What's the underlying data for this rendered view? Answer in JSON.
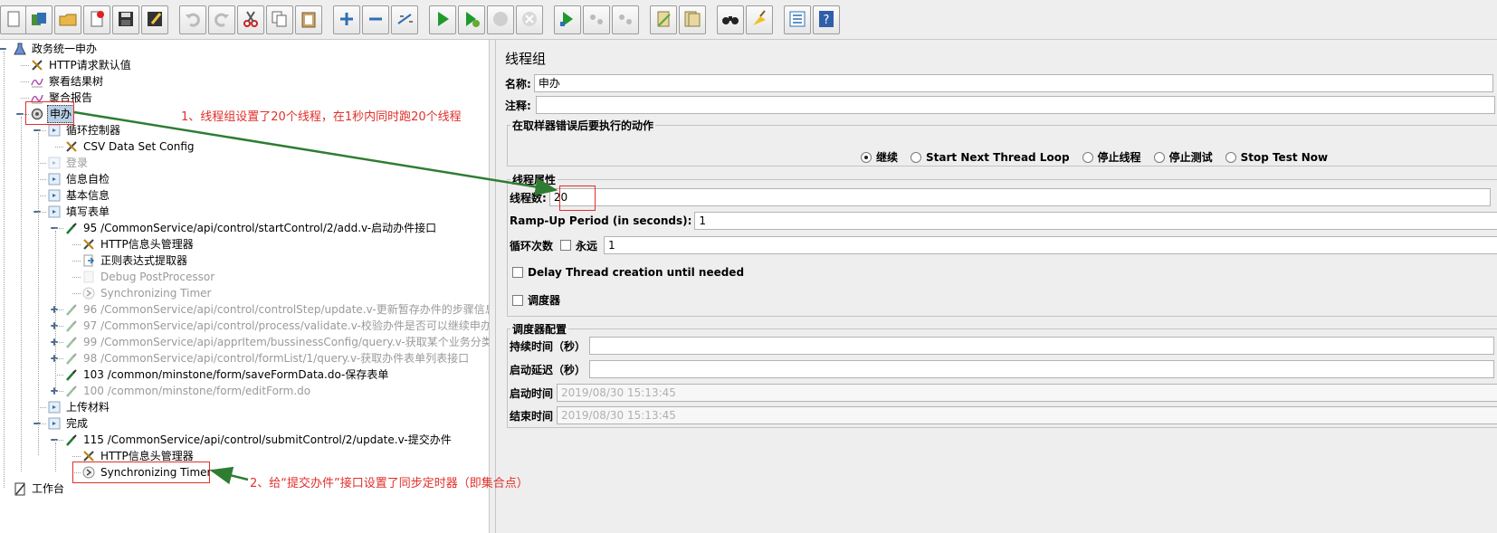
{
  "toolbar": {
    "buttons": [
      {
        "icon": "new-icon"
      },
      {
        "icon": "templates-icon"
      },
      {
        "icon": "open-icon"
      },
      {
        "icon": "close-icon"
      },
      {
        "icon": "save-icon"
      },
      {
        "icon": "save-as-icon"
      },
      {
        "icon": "undo-icon"
      },
      {
        "icon": "redo-icon"
      },
      {
        "icon": "cut-icon"
      },
      {
        "icon": "copy-icon"
      },
      {
        "icon": "paste-icon"
      },
      {
        "icon": "expand-icon"
      },
      {
        "icon": "collapse-icon"
      },
      {
        "icon": "toggle-icon"
      },
      {
        "icon": "start-icon"
      },
      {
        "icon": "start-no-pauses-icon"
      },
      {
        "icon": "stop-icon"
      },
      {
        "icon": "shutdown-icon"
      },
      {
        "icon": "remote-start-icon"
      },
      {
        "icon": "remote-stop-icon"
      },
      {
        "icon": "remote-shutdown-icon"
      },
      {
        "icon": "clear-icon"
      },
      {
        "icon": "clear-all-icon"
      },
      {
        "icon": "search-icon"
      },
      {
        "icon": "reset-search-icon"
      },
      {
        "icon": "function-helper-icon"
      },
      {
        "icon": "help-icon"
      }
    ]
  },
  "tree": {
    "nodes": [
      {
        "label": "政务统一申办",
        "icon": "test-plan-icon",
        "level": 0,
        "disabled": false
      },
      {
        "label": "HTTP请求默认值",
        "icon": "config-wrench-icon",
        "level": 1,
        "disabled": false
      },
      {
        "label": "察看结果树",
        "icon": "listener-graph-icon",
        "level": 1,
        "disabled": false
      },
      {
        "label": "聚合报告",
        "icon": "listener-graph-icon",
        "level": 1,
        "disabled": false
      },
      {
        "label": "申办",
        "icon": "thread-group-gear-icon",
        "level": 1,
        "disabled": false,
        "selected": true
      },
      {
        "label": "循环控制器",
        "icon": "controller-icon",
        "level": 2,
        "disabled": false
      },
      {
        "label": "CSV Data Set Config",
        "icon": "config-wrench-icon",
        "level": 3,
        "disabled": false
      },
      {
        "label": "登录",
        "icon": "controller-icon",
        "level": 2,
        "disabled": true
      },
      {
        "label": "信息自检",
        "icon": "controller-icon",
        "level": 2,
        "disabled": false
      },
      {
        "label": "基本信息",
        "icon": "controller-icon",
        "level": 2,
        "disabled": false
      },
      {
        "label": "填写表单",
        "icon": "controller-icon",
        "level": 2,
        "disabled": false
      },
      {
        "label": "95 /CommonService/api/control/startControl/2/add.v-启动办件接口",
        "icon": "sampler-pipette-icon",
        "level": 3,
        "disabled": false
      },
      {
        "label": "HTTP信息头管理器",
        "icon": "config-wrench-icon",
        "level": 4,
        "disabled": false
      },
      {
        "label": "正则表达式提取器",
        "icon": "extractor-icon",
        "level": 4,
        "disabled": false
      },
      {
        "label": "Debug PostProcessor",
        "icon": "postprocessor-icon",
        "level": 4,
        "disabled": true
      },
      {
        "label": "Synchronizing Timer",
        "icon": "timer-icon",
        "level": 4,
        "disabled": true
      },
      {
        "label": "96 /CommonService/api/control/controlStep/update.v-更新暂存办件的步骤信息接口",
        "icon": "sampler-pipette-icon",
        "level": 3,
        "disabled": true
      },
      {
        "label": "97 /CommonService/api/control/process/validate.v-校验办件是否可以继续申办接口",
        "icon": "sampler-pipette-icon",
        "level": 3,
        "disabled": true
      },
      {
        "label": "99 /CommonService/api/apprItem/bussinessConfig/query.v-获取某个业务分类的配置信",
        "icon": "sampler-pipette-icon",
        "level": 3,
        "disabled": true
      },
      {
        "label": "98 /CommonService/api/control/formList/1/query.v-获取办件表单列表接口",
        "icon": "sampler-pipette-icon",
        "level": 3,
        "disabled": true
      },
      {
        "label": "103 /common/minstone/form/saveFormData.do-保存表单",
        "icon": "sampler-pipette-icon",
        "level": 3,
        "disabled": false
      },
      {
        "label": "100 /common/minstone/form/editForm.do",
        "icon": "sampler-pipette-icon",
        "level": 3,
        "disabled": true
      },
      {
        "label": "上传材料",
        "icon": "controller-icon",
        "level": 2,
        "disabled": false
      },
      {
        "label": "完成",
        "icon": "controller-icon",
        "level": 2,
        "disabled": false
      },
      {
        "label": "115 /CommonService/api/control/submitControl/2/update.v-提交办件",
        "icon": "sampler-pipette-icon",
        "level": 3,
        "disabled": false
      },
      {
        "label": "HTTP信息头管理器",
        "icon": "config-wrench-icon",
        "level": 4,
        "disabled": false
      },
      {
        "label": "Synchronizing Timer",
        "icon": "timer-icon",
        "level": 4,
        "disabled": false
      },
      {
        "label": "工作台",
        "icon": "workbench-icon",
        "level": 0,
        "disabled": false
      }
    ]
  },
  "panel": {
    "title": "线程组",
    "name_label": "名称:",
    "name_value": "申办",
    "comment_label": "注释:",
    "comment_value": "",
    "on_error": {
      "legend": "在取样器错误后要执行的动作",
      "options": [
        {
          "label": "继续",
          "selected": true
        },
        {
          "label": "Start Next Thread Loop",
          "selected": false
        },
        {
          "label": "停止线程",
          "selected": false
        },
        {
          "label": "停止测试",
          "selected": false
        },
        {
          "label": "Stop Test Now",
          "selected": false
        }
      ]
    },
    "thread_props": {
      "legend": "线程属性",
      "threads_label": "线程数:",
      "threads_value": "20",
      "rampup_label": "Ramp-Up Period (in seconds):",
      "rampup_value": "1",
      "loop_label": "循环次数",
      "forever_label": "永远",
      "forever_checked": false,
      "loop_value": "1",
      "delay_label": "Delay Thread creation until needed",
      "delay_checked": false,
      "scheduler_label": "调度器",
      "scheduler_checked": false
    },
    "scheduler": {
      "legend": "调度器配置",
      "duration_label": "持续时间（秒）",
      "duration_value": "",
      "startup_delay_label": "启动延迟（秒）",
      "startup_delay_value": "",
      "start_time_label": "启动时间",
      "start_time_value": "2019/08/30 15:13:45",
      "end_time_label": "结束时间",
      "end_time_value": "2019/08/30 15:13:45"
    }
  },
  "annotations": {
    "note1": "1、线程组设置了20个线程，在1秒内同时跑20个线程",
    "note2": "2、给“提交办件”接口设置了同步定时器（即集合点）"
  },
  "colors": {
    "annotation_red": "#e0302a",
    "arrow_green": "#2e7d32",
    "selection_blue": "#b8cfe5",
    "panel_bg": "#eeeeee"
  }
}
